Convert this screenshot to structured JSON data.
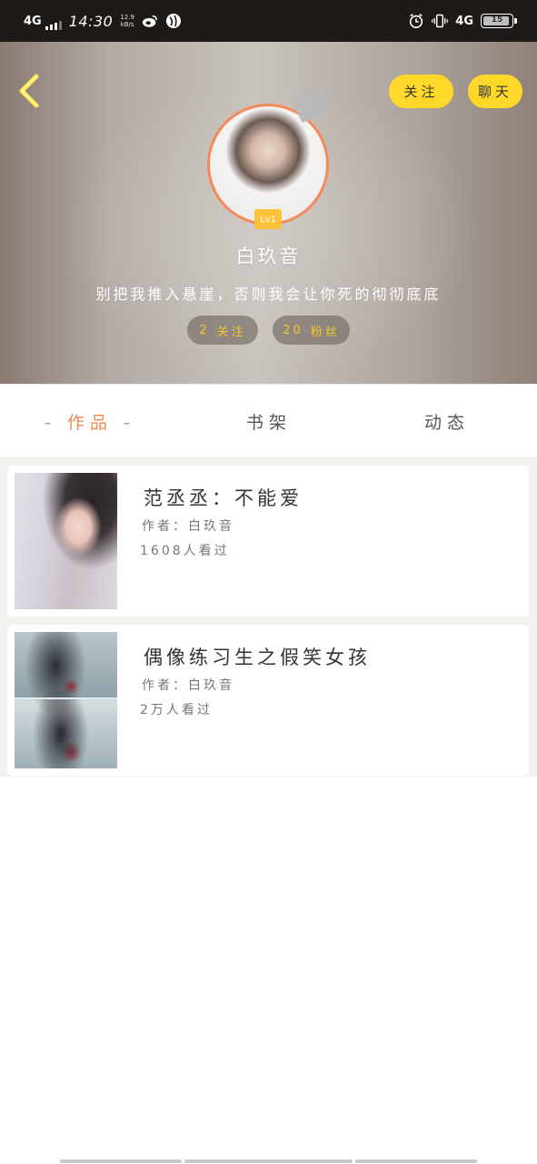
{
  "status_bar": {
    "network": "4G",
    "time": "14:30",
    "speed_value": "12.9",
    "speed_unit": "kB/s",
    "right_network": "4G",
    "battery": "15",
    "icons": [
      "weibo-icon",
      "browser-icon",
      "alarm-icon",
      "vibrate-icon",
      "battery-icon"
    ]
  },
  "header": {
    "follow_label": "关注",
    "chat_label": "聊天",
    "level": "Lv1",
    "username": "白玖音",
    "signature": "别把我推入悬崖，否则我会让你死的彻彻底底",
    "following_count": "2",
    "following_label": "关注",
    "fans_count": "20",
    "fans_label": "粉丝",
    "colors": {
      "button_bg": "#ffd829",
      "avatar_border": "#f38a57",
      "stat_text": "#f5c928"
    }
  },
  "tabs": {
    "works": "- 作品 -",
    "shelf": "书架",
    "dynamics": "动态",
    "active_color": "#f08a52"
  },
  "books": [
    {
      "title": "范丞丞：不能爱",
      "author": "作者：白玖音",
      "views": "1608人看过"
    },
    {
      "title": "偶像练习生之假笑女孩",
      "author": "作者：白玖音",
      "views": "2万人看过"
    }
  ]
}
